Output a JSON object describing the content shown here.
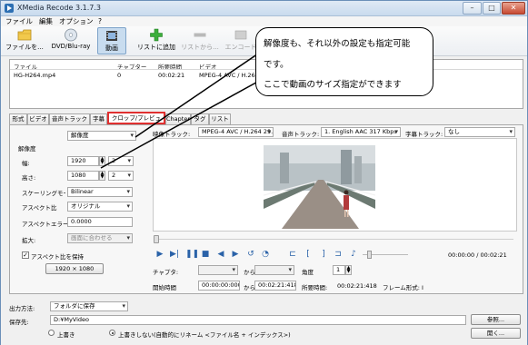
{
  "window": {
    "title": "XMedia Recode 3.1.7.3",
    "minimize": "–",
    "maximize": "□",
    "close": "✕"
  },
  "menu": [
    "ファイル",
    "編集",
    "オプション",
    "?"
  ],
  "toolbar": {
    "open_file": "ファイルを...",
    "dvd_bluray": "DVD/Blu-ray",
    "video": "動画",
    "add_to_list": "リストに追加",
    "remove_from_list": "リストから...",
    "encode": "エンコード"
  },
  "file_table": {
    "headers": [
      "ファイル",
      "チャプター",
      "所要時間",
      "ビデオ"
    ],
    "rows": [
      {
        "file": "HG-H264.mp4",
        "chapter": "0",
        "duration": "00:02:21",
        "video": "MPEG-4 AVC / H.264 24..."
      }
    ]
  },
  "tabs": [
    "形式",
    "ビデオ",
    "音声トラック 1",
    "字幕",
    "クロップ/プレビュー",
    "Chapter",
    "タグ",
    "リスト"
  ],
  "active_tab": "クロップ/プレビュー",
  "crop_panel": {
    "mode": "解像度",
    "section_title": "解像度",
    "width_label": "幅:",
    "width_value": "1920",
    "width_step": "2",
    "height_label": "高さ:",
    "height_value": "1080",
    "height_step": "2",
    "scaling_label": "スケーリングモー ド:",
    "scaling_value": "Bilinear",
    "aspect_label": "アスペクト比",
    "aspect_value": "オリジナル",
    "aspect_error_label": "アスペクトエラー:",
    "aspect_error_value": "0.0000",
    "zoom_label": "拡大:",
    "zoom_value": "画面に合わせる",
    "keep_aspect_label": "アスペクト比を保持",
    "resolution_button": "1920 × 1080"
  },
  "preview": {
    "video_track_label": "映像トラック:",
    "video_track_value": "MPEG-4 AVC / H.264 29.97",
    "audio_track_label": "音声トラック:",
    "audio_track_value": "1. English AAC 317 Kbps",
    "subtitle_track_label": "字幕トラック:",
    "subtitle_track_value": "なし",
    "time_display": "00:00:00 / 00:02:21",
    "chapter_label": "チャプタ:",
    "from_label": "から",
    "angle_label": "角度",
    "angle_value": "1",
    "start_time_label": "開始時間",
    "start_time_value": "00:00:00:000",
    "end_time_value": "00:02:21:418",
    "duration_label": "所要時間:",
    "duration_value": "00:02:21:418",
    "frame_type_label": "フレーム形式: I"
  },
  "output": {
    "method_label": "出力方法:",
    "method_value": "フォルダに保存",
    "destination_label": "保存先:",
    "destination_value": "D:¥MyVideo",
    "browse_button": "参照...",
    "open_button": "開く...",
    "overwrite_label": "上書き",
    "no_overwrite_label": "上書きしない(自動的にリネーム <ファイル名 + インデックス>)"
  },
  "callout": {
    "line1": "解像度も、それ以外の設定も指定可能",
    "line2": "です。",
    "line3": "ここで動画のサイズ指定ができます"
  },
  "colors": {
    "active_tab_border": "#e03030",
    "accent_blue": "#2a62a8"
  },
  "timeline_position": 0.0,
  "volume_level": 0.15
}
